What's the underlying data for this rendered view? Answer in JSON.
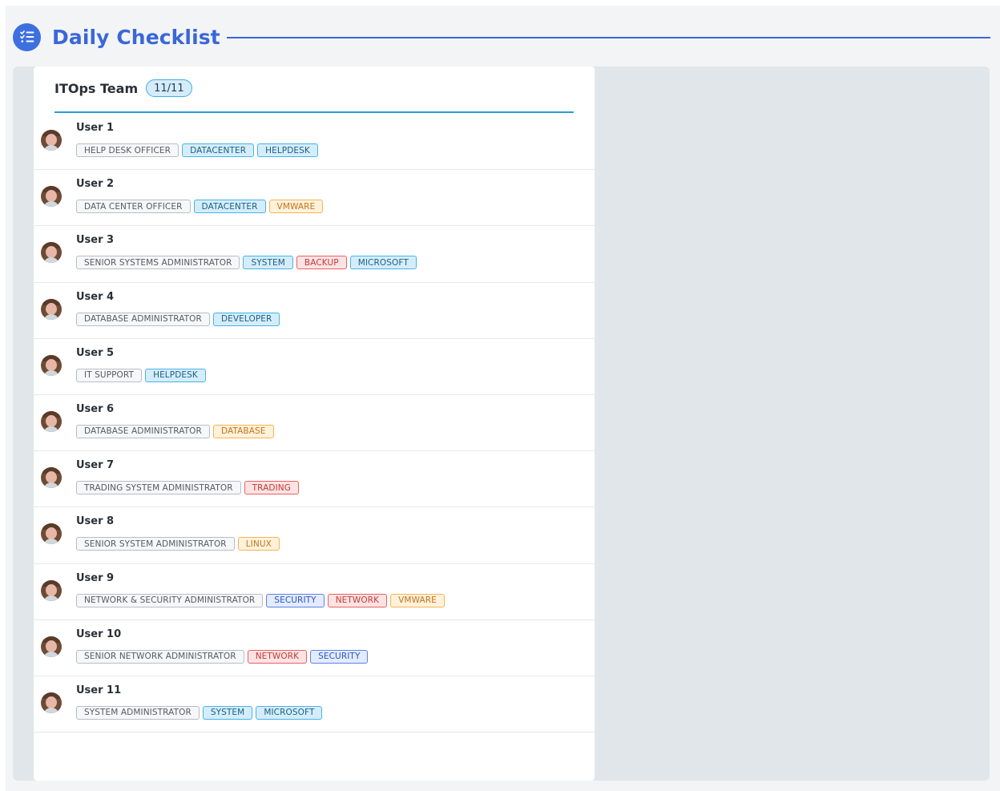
{
  "header": {
    "title": "Daily Checklist",
    "icon": "checklist-icon"
  },
  "colors": {
    "accent": "#3a67d8",
    "team_rule": "#2a9cd8",
    "panel": "#e1e6ea"
  },
  "team": {
    "name": "ITOps Team",
    "count": "11/11"
  },
  "users": [
    {
      "name": "User 1",
      "role": "HELP DESK OFFICER",
      "tags": [
        {
          "label": "DATACENTER",
          "style": "cyan"
        },
        {
          "label": "HELPDESK",
          "style": "cyan"
        }
      ]
    },
    {
      "name": "User 2",
      "role": "DATA CENTER OFFICER",
      "tags": [
        {
          "label": "DATACENTER",
          "style": "cyan"
        },
        {
          "label": "VMWARE",
          "style": "orange"
        }
      ]
    },
    {
      "name": "User 3",
      "role": "SENIOR SYSTEMS ADMINISTRATOR",
      "tags": [
        {
          "label": "SYSTEM",
          "style": "cyan"
        },
        {
          "label": "BACKUP",
          "style": "red"
        },
        {
          "label": "MICROSOFT",
          "style": "cyan"
        }
      ]
    },
    {
      "name": "User 4",
      "role": "DATABASE ADMINISTRATOR",
      "tags": [
        {
          "label": "DEVELOPER",
          "style": "cyan"
        }
      ]
    },
    {
      "name": "User 5",
      "role": "IT SUPPORT",
      "tags": [
        {
          "label": "HELPDESK",
          "style": "cyan"
        }
      ]
    },
    {
      "name": "User 6",
      "role": "DATABASE ADMINISTRATOR",
      "tags": [
        {
          "label": "DATABASE",
          "style": "orange"
        }
      ]
    },
    {
      "name": "User 7",
      "role": "TRADING SYSTEM ADMINISTRATOR",
      "tags": [
        {
          "label": "TRADING",
          "style": "red"
        }
      ]
    },
    {
      "name": "User 8",
      "role": "SENIOR SYSTEM ADMINISTRATOR",
      "tags": [
        {
          "label": "LINUX",
          "style": "orange"
        }
      ]
    },
    {
      "name": "User 9",
      "role": "NETWORK & SECURITY ADMINISTRATOR",
      "tags": [
        {
          "label": "SECURITY",
          "style": "blue"
        },
        {
          "label": "NETWORK",
          "style": "red"
        },
        {
          "label": "VMWARE",
          "style": "orange"
        }
      ]
    },
    {
      "name": "User 10",
      "role": "SENIOR NETWORK ADMINISTRATOR",
      "tags": [
        {
          "label": "NETWORK",
          "style": "red"
        },
        {
          "label": "SECURITY",
          "style": "blue"
        }
      ]
    },
    {
      "name": "User 11",
      "role": "SYSTEM ADMINISTRATOR",
      "tags": [
        {
          "label": "SYSTEM",
          "style": "cyan"
        },
        {
          "label": "MICROSOFT",
          "style": "cyan"
        }
      ]
    }
  ]
}
